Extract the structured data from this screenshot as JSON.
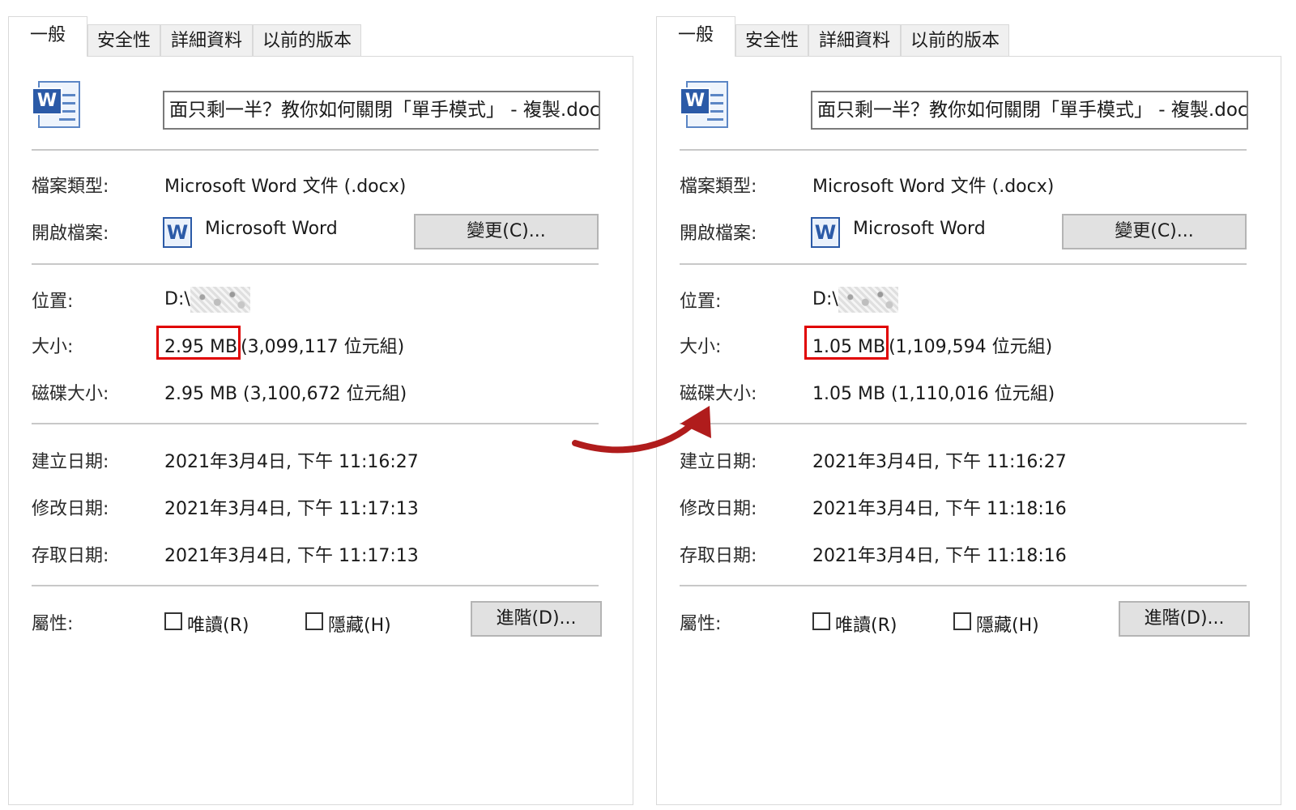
{
  "tabs": [
    "一般",
    "安全性",
    "詳細資料",
    "以前的版本"
  ],
  "labels": {
    "type": "檔案類型:",
    "opens_with": "開啟檔案:",
    "location": "位置:",
    "size": "大小:",
    "size_on_disk": "磁碟大小:",
    "created": "建立日期:",
    "modified": "修改日期:",
    "accessed": "存取日期:",
    "attributes": "屬性:"
  },
  "buttons": {
    "change": "變更(C)...",
    "advanced": "進階(D)..."
  },
  "checkboxes": {
    "readonly": "唯讀(R)",
    "hidden": "隱藏(H)"
  },
  "left": {
    "filename": "面只剩一半？教你如何關閉「單手模式」 - 複製.docx",
    "type": "Microsoft Word 文件 (.docx)",
    "opens_with": "Microsoft Word",
    "location": "D:\\",
    "size_highlight": "2.95 MB",
    "size_rest": "(3,099,117 位元組)",
    "size_on_disk": "2.95 MB (3,100,672 位元組)",
    "created": "2021年3月4日, 下午 11:16:27",
    "modified": "2021年3月4日, 下午 11:17:13",
    "accessed": "2021年3月4日, 下午 11:17:13"
  },
  "right": {
    "filename": "面只剩一半？教你如何關閉「單手模式」 - 複製.docx",
    "type": "Microsoft Word 文件 (.docx)",
    "opens_with": "Microsoft Word",
    "location": "D:\\",
    "size_highlight": "1.05 MB",
    "size_rest": "(1,109,594 位元組)",
    "size_on_disk": "1.05 MB (1,110,016 位元組)",
    "created": "2021年3月4日, 下午 11:16:27",
    "modified": "2021年3月4日, 下午 11:18:16",
    "accessed": "2021年3月4日, 下午 11:18:16"
  },
  "colors": {
    "highlight": "#e00000",
    "arrow": "#b01c1c",
    "word_blue": "#2b5aa7"
  }
}
